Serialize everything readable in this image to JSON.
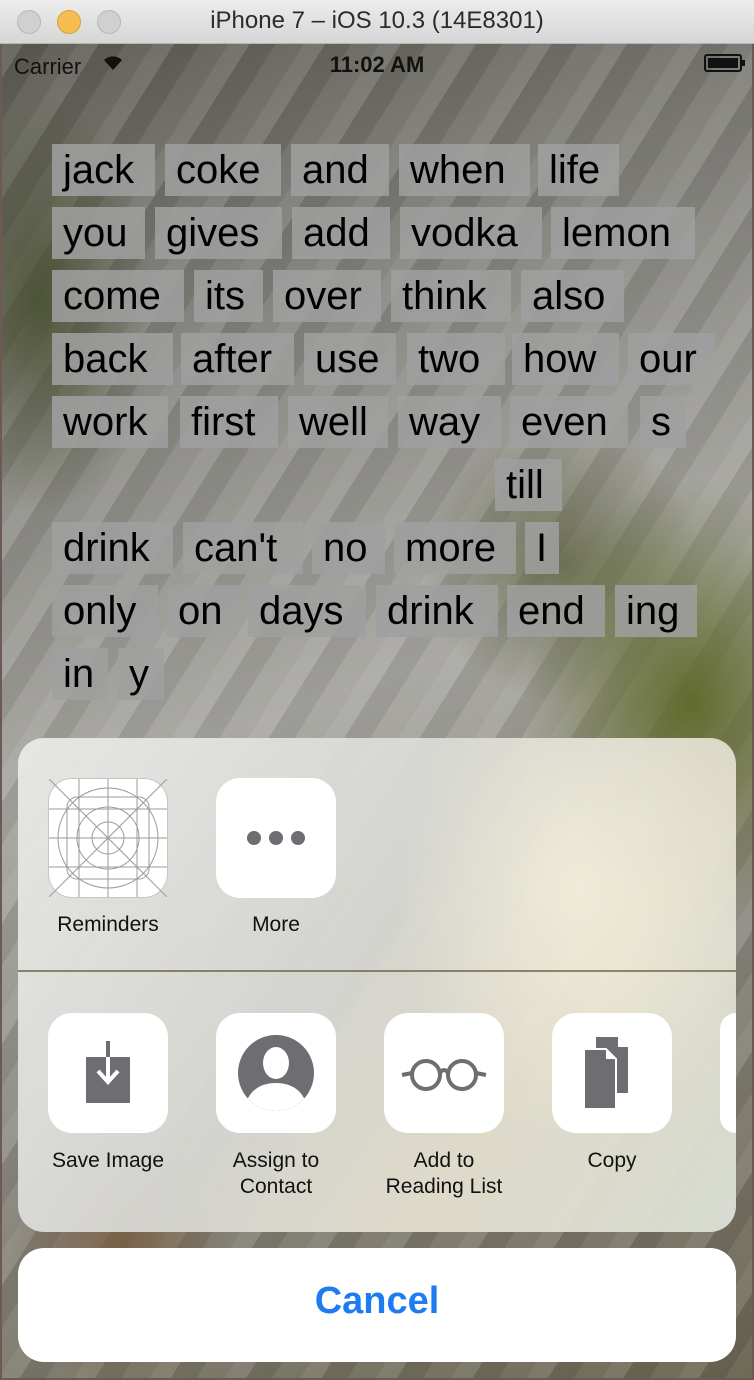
{
  "window": {
    "title": "iPhone 7 – iOS 10.3 (14E8301)"
  },
  "status_bar": {
    "carrier": "Carrier",
    "time": "11:02 AM"
  },
  "words": {
    "w0": "jack",
    "w1": "coke",
    "w2": "and",
    "w3": "when",
    "w4": "life",
    "w5": "you",
    "w6": "gives",
    "w7": "add",
    "w8": "vodka",
    "w9": "lemon",
    "w10": "come",
    "w11": "its",
    "w12": "over",
    "w13": "think",
    "w14": "also",
    "w15": "back",
    "w16": "after",
    "w17": "use",
    "w18": "two",
    "w19": "how",
    "w20": "our",
    "w21": "work",
    "w22": "first",
    "w23": "well",
    "w24": "way",
    "w25": "even",
    "w26": "s",
    "w27": "till",
    "w28": "drink",
    "w29": "can't",
    "w30": "no",
    "w31": "more",
    "w32": "I",
    "w33": "only",
    "w34": "on",
    "w35": "days",
    "w36": "drink",
    "w37": "end",
    "w38": "ing",
    "w39": "in",
    "w40": "y"
  },
  "share_sheet": {
    "apps": {
      "reminders": "Reminders",
      "more": "More"
    },
    "actions": {
      "save_image": "Save Image",
      "assign_contact_1": "Assign to",
      "assign_contact_2": "Contact",
      "reading_list_1": "Add to",
      "reading_list_2": "Reading List",
      "copy": "Copy"
    },
    "cancel": "Cancel"
  },
  "colors": {
    "accent": "#1e7cf0",
    "icon_gray": "#6d6d72",
    "tile_bg": "#a0a0a0"
  }
}
